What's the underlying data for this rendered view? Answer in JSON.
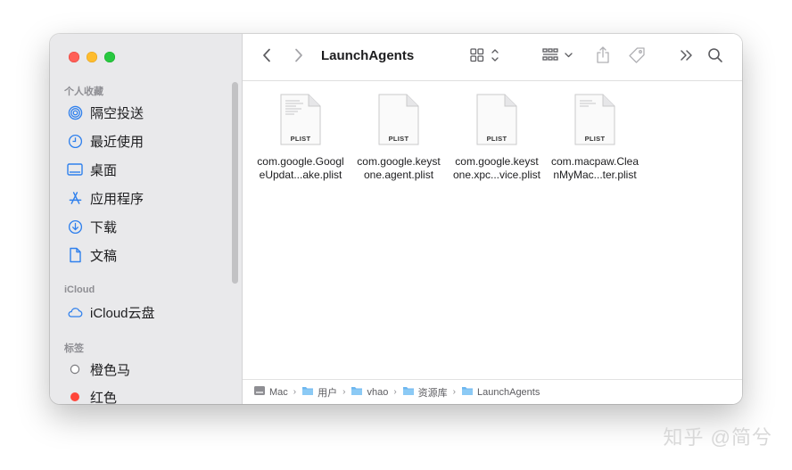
{
  "window": {
    "title": "LaunchAgents"
  },
  "sidebar": {
    "favorites_header": "个人收藏",
    "favorites": [
      {
        "label": "隔空投送",
        "icon": "airdrop-icon"
      },
      {
        "label": "最近使用",
        "icon": "clock-icon"
      },
      {
        "label": "桌面",
        "icon": "desktop-icon"
      },
      {
        "label": "应用程序",
        "icon": "applications-icon"
      },
      {
        "label": "下载",
        "icon": "download-icon"
      },
      {
        "label": "文稿",
        "icon": "document-icon"
      }
    ],
    "icloud_header": "iCloud",
    "icloud": [
      {
        "label": "iCloud云盘",
        "icon": "cloud-icon"
      }
    ],
    "tags_header": "标签",
    "tags": [
      {
        "label": "橙色马",
        "color": "#ffffff"
      },
      {
        "label": "红色",
        "color": "#ff453a"
      }
    ]
  },
  "files": [
    {
      "line1": "com.google.Googl",
      "line2": "eUpdat...ake.plist",
      "kind": "PLIST"
    },
    {
      "line1": "com.google.keyst",
      "line2": "one.agent.plist",
      "kind": "PLIST"
    },
    {
      "line1": "com.google.keyst",
      "line2": "one.xpc...vice.plist",
      "kind": "PLIST"
    },
    {
      "line1": "com.macpaw.Clea",
      "line2": "nMyMac...ter.plist",
      "kind": "PLIST"
    }
  ],
  "pathbar": [
    {
      "label": "Mac",
      "icon": "hard-drive-icon"
    },
    {
      "label": "用户",
      "icon": "folder-icon"
    },
    {
      "label": "vhao",
      "icon": "folder-icon"
    },
    {
      "label": "资源库",
      "icon": "folder-icon"
    },
    {
      "label": "LaunchAgents",
      "icon": "folder-icon"
    }
  ],
  "watermark": "知乎 @简兮",
  "colors": {
    "accent": "#2f80ed",
    "folder": "#6cb6f0"
  }
}
